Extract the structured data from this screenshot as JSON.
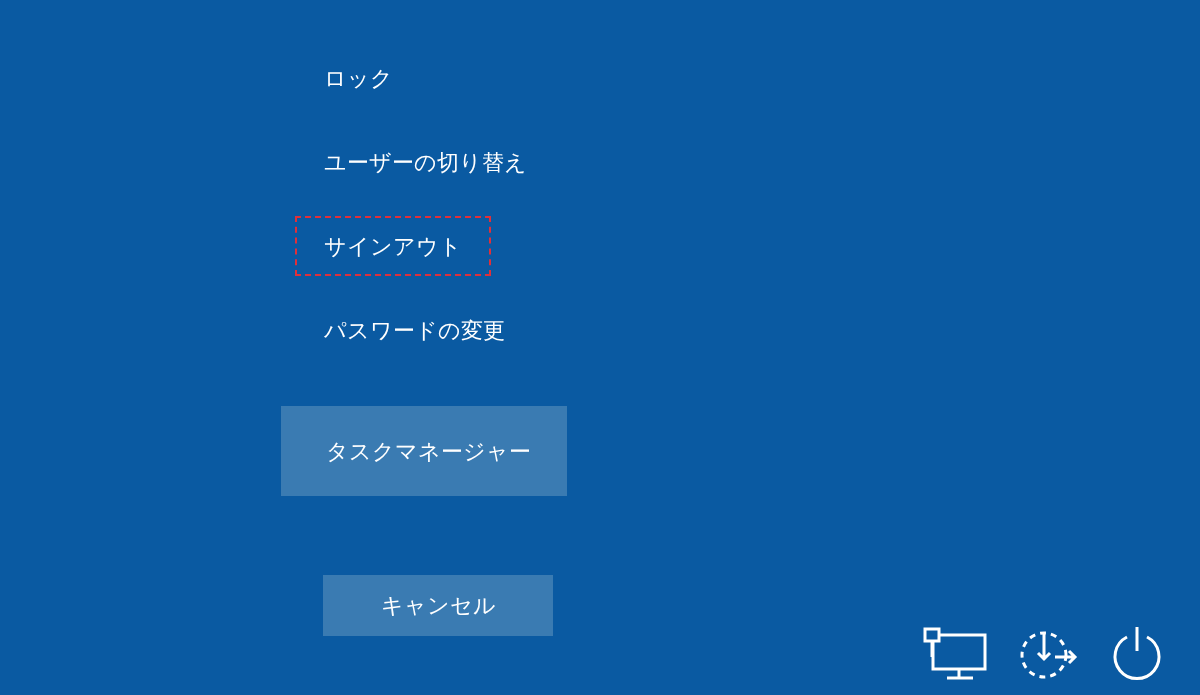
{
  "menu_items": [
    {
      "label": "ロック",
      "focused": false
    },
    {
      "label": "ユーザーの切り替え",
      "focused": false
    },
    {
      "label": "サインアウト",
      "focused": true
    },
    {
      "label": "パスワードの変更",
      "focused": false
    }
  ],
  "task_manager_button": {
    "label": "タスクマネージャー"
  },
  "cancel_button": {
    "label": "キャンセル"
  }
}
